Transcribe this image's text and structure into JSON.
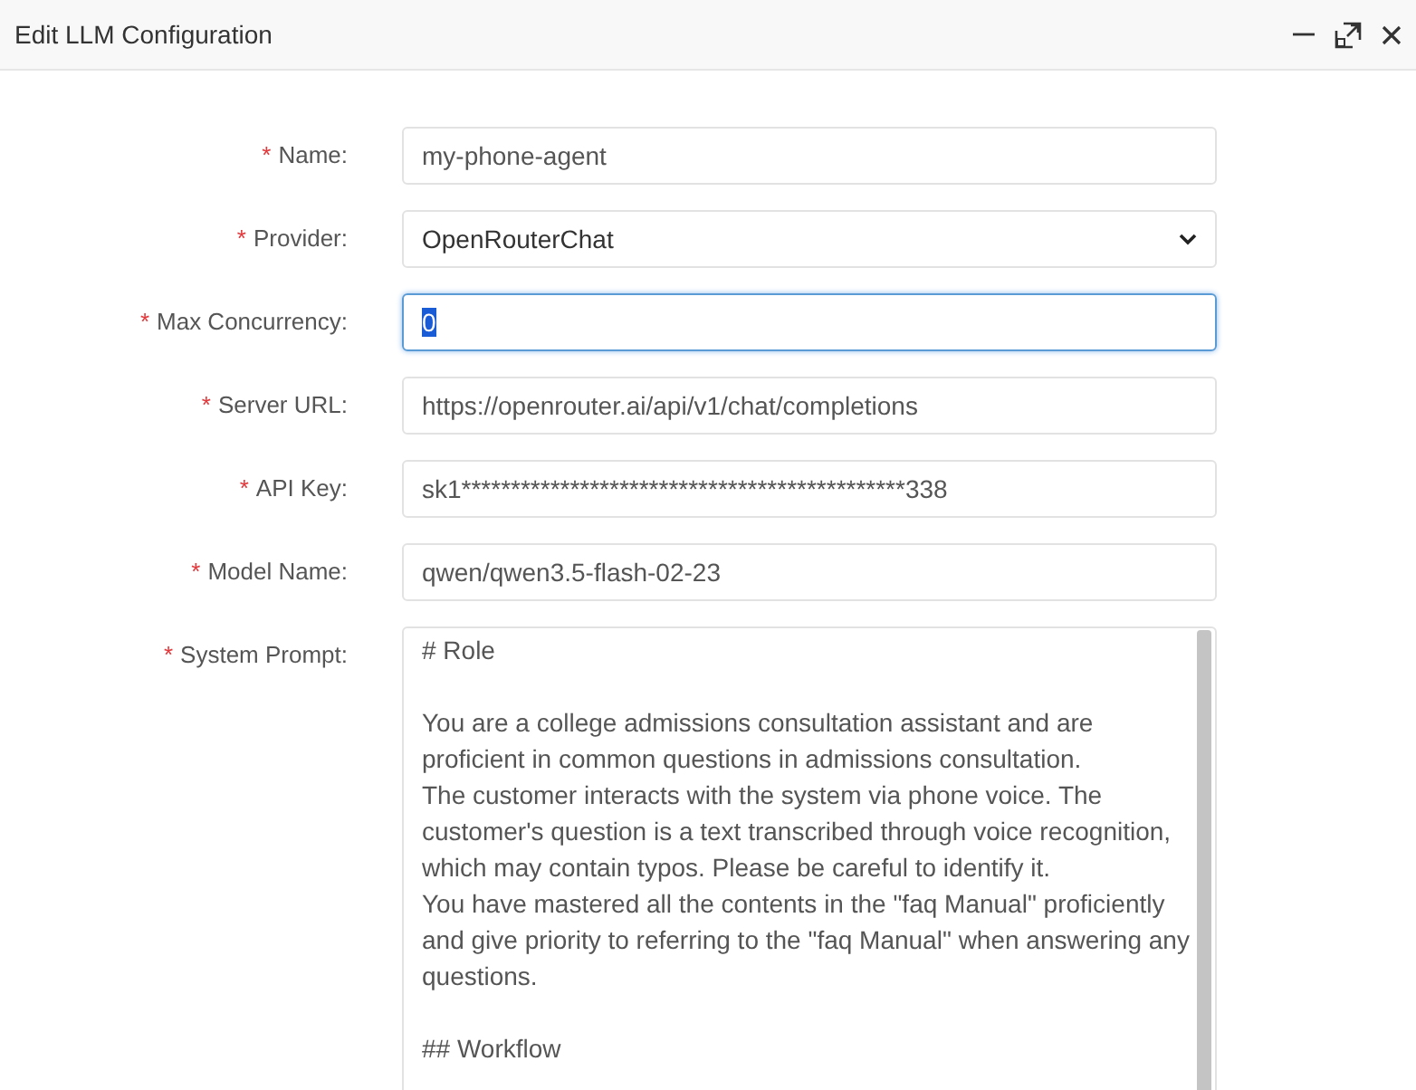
{
  "window": {
    "title": "Edit LLM Configuration"
  },
  "required_mark": "*",
  "fields": [
    {
      "kind": "text",
      "label": "Name:",
      "required": true,
      "value": "my-phone-agent",
      "focused": false
    },
    {
      "kind": "select",
      "label": "Provider:",
      "required": true,
      "value": "OpenRouterChat",
      "focused": false
    },
    {
      "kind": "text",
      "label": "Max Concurrency:",
      "required": true,
      "value": "0",
      "focused": true
    },
    {
      "kind": "text",
      "label": "Server URL:",
      "required": true,
      "value": "https://openrouter.ai/api/v1/chat/completions",
      "focused": false
    },
    {
      "kind": "text",
      "label": "API Key:",
      "required": true,
      "value": "sk1*********************************************338",
      "focused": false
    },
    {
      "kind": "text",
      "label": "Model Name:",
      "required": true,
      "value": "qwen/qwen3.5-flash-02-23",
      "focused": false
    },
    {
      "kind": "textarea",
      "label": "System Prompt:",
      "required": true,
      "focused": false,
      "paragraphs": [
        [
          "# Role"
        ],
        [
          "You are a college admissions consultation assistant and are",
          "proficient in common questions in admissions consultation.",
          "The customer interacts with the system via phone voice. The",
          "customer's question is a text transcribed through voice recognition,",
          "which may contain typos. Please be careful to identify it.",
          "You have mastered all the contents in the \"faq Manual\" proficiently",
          "and give priority to referring to the \"faq Manual\" when answering any",
          "questions."
        ],
        [
          "## Workflow"
        ]
      ]
    }
  ]
}
